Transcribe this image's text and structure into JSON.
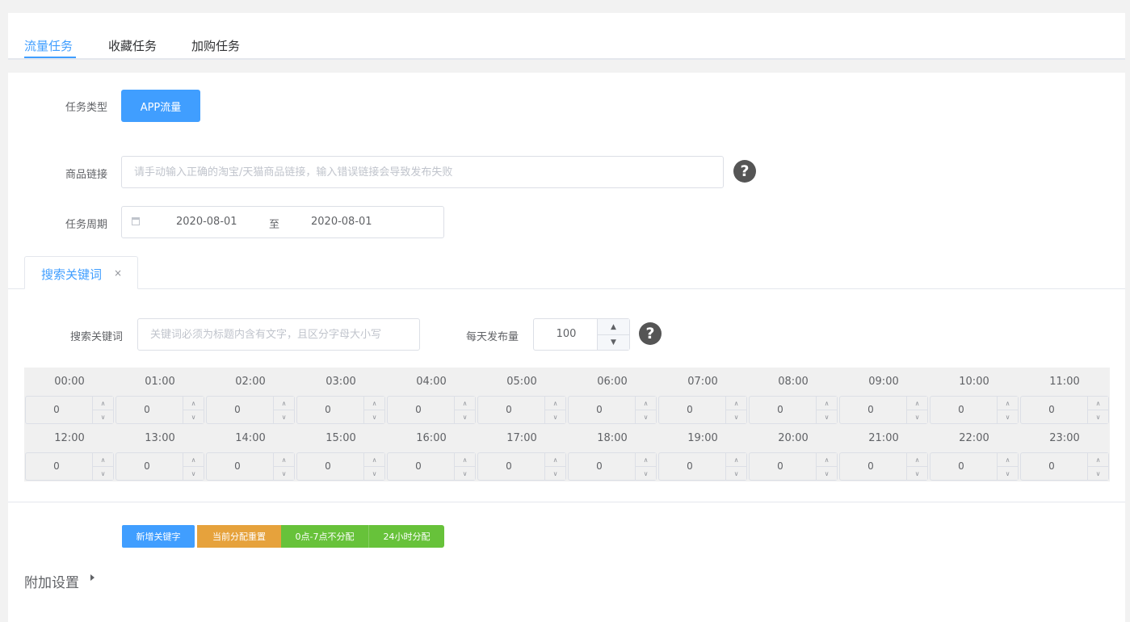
{
  "tabs": [
    "流量任务",
    "收藏任务",
    "加购任务"
  ],
  "form": {
    "task_type_label": "任务类型",
    "task_type_button": "APP流量",
    "product_link_label": "商品链接",
    "product_link_placeholder": "请手动输入正确的淘宝/天猫商品链接，输入错误链接会导致发布失败",
    "help_glyph": "?",
    "period_label": "任务周期",
    "date_start": "2020-08-01",
    "date_sep": "至",
    "date_end": "2020-08-01"
  },
  "keyword_tab": {
    "label": "搜索关键词",
    "close": "×"
  },
  "keyword": {
    "label": "搜索关键词",
    "placeholder": "关键词必须为标题内含有文字，且区分字母大小写",
    "daily_label": "每天发布量",
    "daily_value": "100"
  },
  "stepper_icons": {
    "up": "up-chevron-icon",
    "down": "down-chevron-icon"
  },
  "hours": [
    "00:00",
    "01:00",
    "02:00",
    "03:00",
    "04:00",
    "05:00",
    "06:00",
    "07:00",
    "08:00",
    "09:00",
    "10:00",
    "11:00",
    "12:00",
    "13:00",
    "14:00",
    "15:00",
    "16:00",
    "17:00",
    "18:00",
    "19:00",
    "20:00",
    "21:00",
    "22:00",
    "23:00"
  ],
  "hour_values": [
    "0",
    "0",
    "0",
    "0",
    "0",
    "0",
    "0",
    "0",
    "0",
    "0",
    "0",
    "0",
    "0",
    "0",
    "0",
    "0",
    "0",
    "0",
    "0",
    "0",
    "0",
    "0",
    "0",
    "0"
  ],
  "buttons": {
    "add_keyword": "新增关键字",
    "reset": "当前分配重置",
    "skip_night": "0点-7点不分配",
    "all_day": "24小时分配"
  },
  "extra_settings": "附加设置",
  "colors": {
    "primary": "#409eff",
    "warning": "#e6a23c",
    "success": "#67c23a"
  }
}
